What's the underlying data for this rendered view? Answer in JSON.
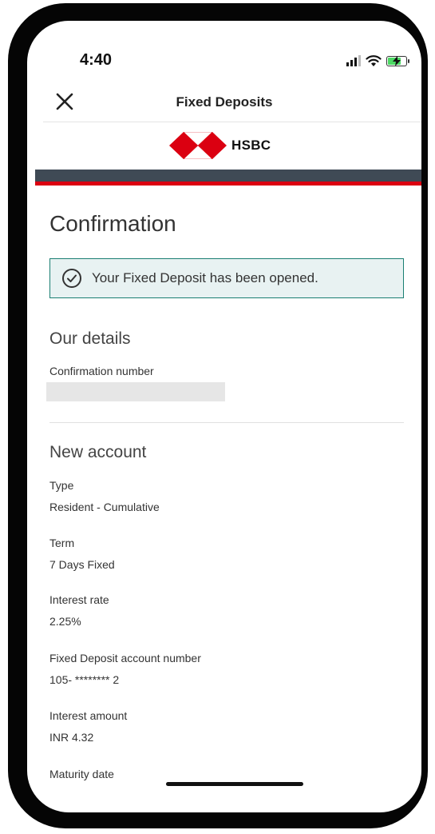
{
  "status_bar": {
    "time": "4:40",
    "icons": [
      "cellular-signal-icon",
      "wifi-icon",
      "battery-charging-icon"
    ]
  },
  "nav": {
    "close_icon": "close-icon",
    "title": "Fixed Deposits"
  },
  "brand": {
    "name": "HSBC",
    "logo_icon": "hsbc-hexagon-logo",
    "colors": {
      "red": "#db0011",
      "dark_band": "#3f4a55",
      "success_border": "#1a7f72",
      "success_bg": "#e8f2f2"
    }
  },
  "page": {
    "title": "Confirmation"
  },
  "alert": {
    "icon": "check-circle-icon",
    "message": "Your Fixed Deposit has been opened."
  },
  "our_details": {
    "title": "Our details",
    "confirmation_label": "Confirmation number"
  },
  "new_account": {
    "title": "New account",
    "fields": [
      {
        "label": "Type",
        "value": "Resident - Cumulative"
      },
      {
        "label": "Term",
        "value": "7 Days Fixed"
      },
      {
        "label": "Interest rate",
        "value": "2.25%"
      },
      {
        "label": "Fixed Deposit account number",
        "value": "105- ******** 2"
      },
      {
        "label": "Interest amount",
        "value": "INR 4.32"
      },
      {
        "label": "Maturity date",
        "value": ""
      }
    ]
  }
}
